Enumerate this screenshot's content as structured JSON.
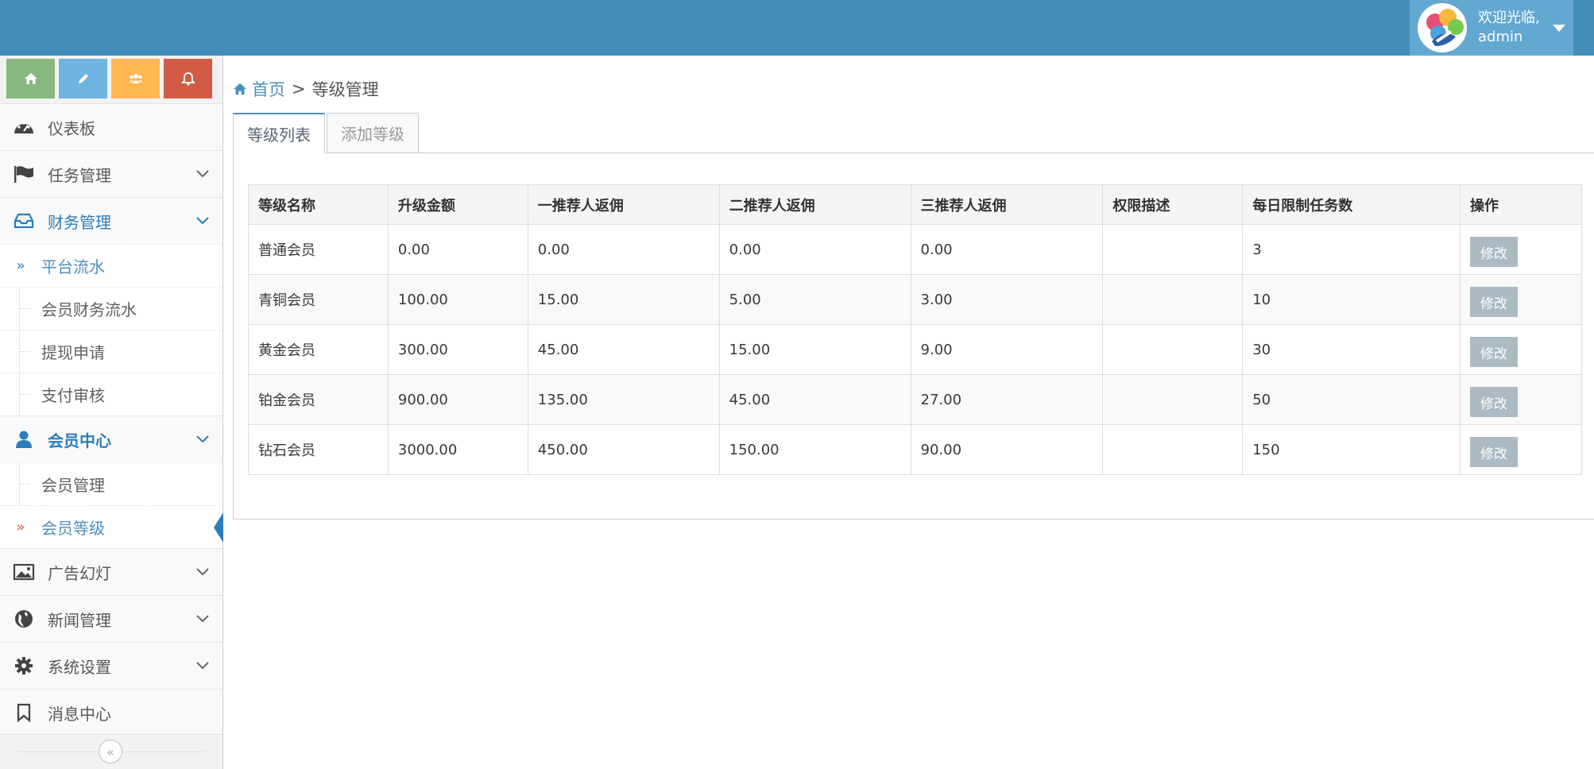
{
  "header": {
    "welcome": "欢迎光临,",
    "username": "admin"
  },
  "colors": {
    "navbar": "#438eb9",
    "user_box": "#62a8d1",
    "accent": "#2b7dbc",
    "sc_home": "#87b87f",
    "sc_edit": "#6fb3e0",
    "sc_users": "#ffb752",
    "sc_bell": "#d15b47",
    "edit_button": "#abbac3"
  },
  "shortcuts": [
    {
      "icon": "home-icon"
    },
    {
      "icon": "pencil-icon"
    },
    {
      "icon": "users-icon"
    },
    {
      "icon": "bell-icon"
    }
  ],
  "sidebar": {
    "dashboard": "仪表板",
    "tasks": "任务管理",
    "finance": "财务管理",
    "finance_items": [
      "平台流水",
      "会员财务流水",
      "提现申请",
      "支付审核"
    ],
    "members": "会员中心",
    "member_items": [
      "会员管理",
      "会员等级"
    ],
    "ads": "广告幻灯",
    "news": "新闻管理",
    "settings": "系统设置",
    "messages": "消息中心",
    "sub_arrow": "»",
    "collapse": "«"
  },
  "breadcrumb": {
    "home": "首页",
    "separator": ">",
    "current": "等级管理"
  },
  "tabs": [
    "等级列表",
    "添加等级"
  ],
  "table": {
    "headers": [
      "等级名称",
      "升级金额",
      "一推荐人返佣",
      "二推荐人返佣",
      "三推荐人返佣",
      "权限描述",
      "每日限制任务数",
      "操作"
    ],
    "rows": [
      [
        "普通会员",
        "0.00",
        "0.00",
        "0.00",
        "0.00",
        "",
        "3",
        "修改"
      ],
      [
        "青铜会员",
        "100.00",
        "15.00",
        "5.00",
        "3.00",
        "",
        "10",
        "修改"
      ],
      [
        "黄金会员",
        "300.00",
        "45.00",
        "15.00",
        "9.00",
        "",
        "30",
        "修改"
      ],
      [
        "铂金会员",
        "900.00",
        "135.00",
        "45.00",
        "27.00",
        "",
        "50",
        "修改"
      ],
      [
        "钻石会员",
        "3000.00",
        "450.00",
        "150.00",
        "90.00",
        "",
        "150",
        "修改"
      ]
    ]
  }
}
